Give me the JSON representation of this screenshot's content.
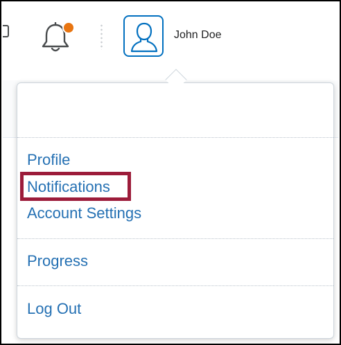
{
  "topbar": {
    "left_edge_icon": "box-edge-icon",
    "notifications_icon": "bell-icon",
    "notification_dot_color": "#e87511",
    "avatar_icon": "user-silhouette-icon",
    "avatar_border_color": "#006fbf",
    "user_name": "John Doe"
  },
  "menu": {
    "items": [
      {
        "label": "Profile"
      },
      {
        "label": "Notifications",
        "highlighted": true
      },
      {
        "label": "Account Settings"
      },
      {
        "label": "Progress"
      },
      {
        "label": "Log Out"
      }
    ],
    "link_color": "#2470b3",
    "highlight_color": "#9c1c3a"
  }
}
